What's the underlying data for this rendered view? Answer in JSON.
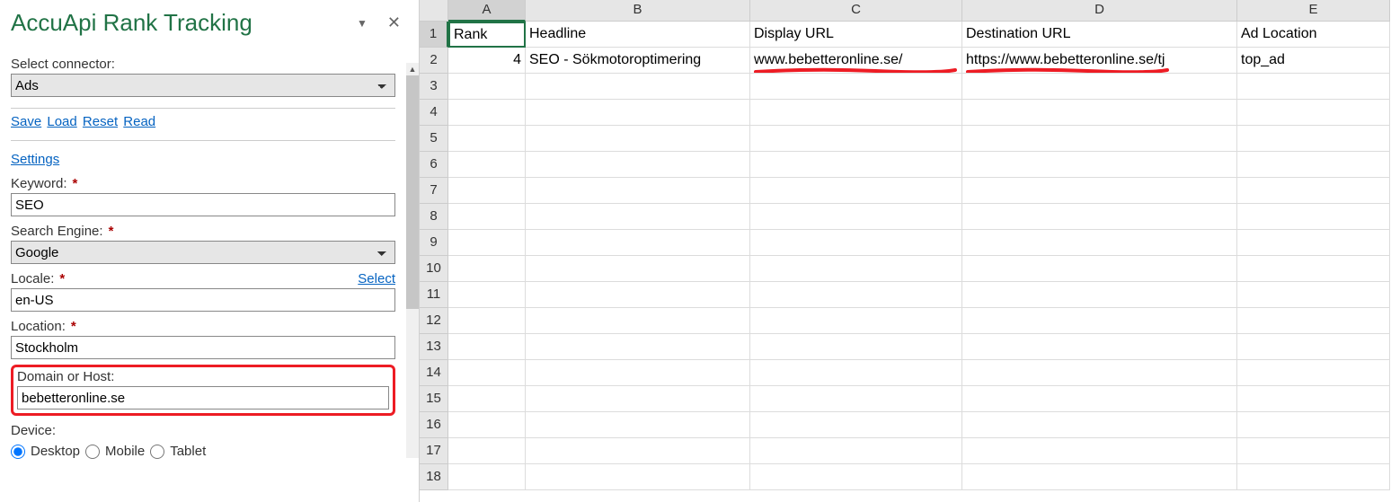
{
  "sidebar": {
    "title": "AccuApi Rank Tracking",
    "connector_label": "Select connector:",
    "connector_value": "Ads",
    "links": {
      "save": "Save",
      "load": "Load",
      "reset": "Reset",
      "read": "Read"
    },
    "settings_link": "Settings",
    "keyword_label": "Keyword:",
    "keyword_value": "SEO",
    "engine_label": "Search Engine:",
    "engine_value": "Google",
    "locale_label": "Locale:",
    "locale_select_link": "Select",
    "locale_value": "en-US",
    "location_label": "Location:",
    "location_value": "Stockholm",
    "domain_label": "Domain or Host:",
    "domain_value": "bebetteronline.se",
    "device_label": "Device:",
    "devices": {
      "desktop": "Desktop",
      "mobile": "Mobile",
      "tablet": "Tablet"
    }
  },
  "sheet": {
    "columns": [
      "A",
      "B",
      "C",
      "D",
      "E"
    ],
    "selected_cell": "A1",
    "rows": [
      {
        "n": 1,
        "cells": [
          "Rank",
          "Headline",
          "Display URL",
          "Destination URL",
          "Ad Location"
        ]
      },
      {
        "n": 2,
        "cells": [
          "4",
          "SEO - Sökmotoroptimering",
          "www.bebetteronline.se/",
          "https://www.bebetteronline.se/tj",
          "top_ad"
        ]
      },
      {
        "n": 3,
        "cells": [
          "",
          "",
          "",
          "",
          ""
        ]
      },
      {
        "n": 4,
        "cells": [
          "",
          "",
          "",
          "",
          ""
        ]
      },
      {
        "n": 5,
        "cells": [
          "",
          "",
          "",
          "",
          ""
        ]
      },
      {
        "n": 6,
        "cells": [
          "",
          "",
          "",
          "",
          ""
        ]
      },
      {
        "n": 7,
        "cells": [
          "",
          "",
          "",
          "",
          ""
        ]
      },
      {
        "n": 8,
        "cells": [
          "",
          "",
          "",
          "",
          ""
        ]
      },
      {
        "n": 9,
        "cells": [
          "",
          "",
          "",
          "",
          ""
        ]
      },
      {
        "n": 10,
        "cells": [
          "",
          "",
          "",
          "",
          ""
        ]
      },
      {
        "n": 11,
        "cells": [
          "",
          "",
          "",
          "",
          ""
        ]
      },
      {
        "n": 12,
        "cells": [
          "",
          "",
          "",
          "",
          ""
        ]
      },
      {
        "n": 13,
        "cells": [
          "",
          "",
          "",
          "",
          ""
        ]
      },
      {
        "n": 14,
        "cells": [
          "",
          "",
          "",
          "",
          ""
        ]
      },
      {
        "n": 15,
        "cells": [
          "",
          "",
          "",
          "",
          ""
        ]
      },
      {
        "n": 16,
        "cells": [
          "",
          "",
          "",
          "",
          ""
        ]
      },
      {
        "n": 17,
        "cells": [
          "",
          "",
          "",
          "",
          ""
        ]
      },
      {
        "n": 18,
        "cells": [
          "",
          "",
          "",
          "",
          ""
        ]
      }
    ]
  }
}
